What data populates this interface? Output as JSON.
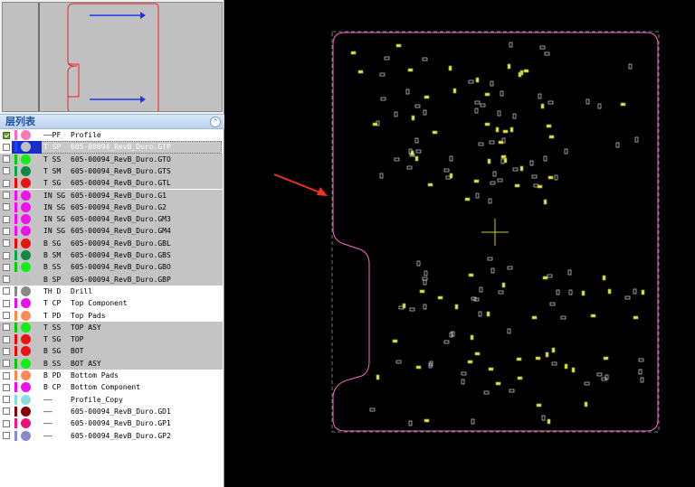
{
  "layer_panel": {
    "title": "层列表",
    "collapse_icon": "chevron-up-icon"
  },
  "layers": [
    {
      "code": "——PF",
      "name": "Profile",
      "bar": "#ff66cc",
      "dot": "#ff77bb",
      "checked": true,
      "shade": "white"
    },
    {
      "code": "T SP",
      "name": "605-00094_RevB_Duro.GTP",
      "bar": "#2040ff",
      "dot": "#c0c0c0",
      "checked": false,
      "shade": "selected"
    },
    {
      "code": "T SS",
      "name": "605-00094_RevB_Duro.GTO",
      "bar": "#00cc00",
      "dot": "#11ee11",
      "checked": false,
      "shade": "grey"
    },
    {
      "code": "T SM",
      "name": "605-00094_RevB_Duro.GTS",
      "bar": "#00aa44",
      "dot": "#118844",
      "checked": false,
      "shade": "grey"
    },
    {
      "code": "T SG",
      "name": "605-00094_RevB_Duro.GTL",
      "bar": "#ff0000",
      "dot": "#ee1111",
      "checked": false,
      "shade": "grey"
    },
    {
      "code": "IN SG",
      "name": "605-00094_RevB_Duro.G1",
      "bar": "#ff00ff",
      "dot": "#ee11ee",
      "checked": false,
      "shade": "grey"
    },
    {
      "code": "IN SG",
      "name": "605-00094_RevB_Duro.G2",
      "bar": "#ff00ff",
      "dot": "#ee11ee",
      "checked": false,
      "shade": "grey"
    },
    {
      "code": "IN SG",
      "name": "605-00094_RevB_Duro.GM3",
      "bar": "#ff00ff",
      "dot": "#ee11ee",
      "checked": false,
      "shade": "grey"
    },
    {
      "code": "IN SG",
      "name": "605-00094_RevB_Duro.GM4",
      "bar": "#ff00ff",
      "dot": "#ee11ee",
      "checked": false,
      "shade": "grey"
    },
    {
      "code": "B SG",
      "name": "605-00094_RevB_Duro.GBL",
      "bar": "#ff0000",
      "dot": "#ee1111",
      "checked": false,
      "shade": "grey"
    },
    {
      "code": "B SM",
      "name": "605-00094_RevB_Duro.GBS",
      "bar": "#00aa44",
      "dot": "#118844",
      "checked": false,
      "shade": "grey"
    },
    {
      "code": "B SS",
      "name": "605-00094_RevB_Duro.GBO",
      "bar": "#00cc00",
      "dot": "#11ee11",
      "checked": false,
      "shade": "grey"
    },
    {
      "code": "B SP",
      "name": "605-00094_RevB_Duro.GBP",
      "bar": "#c0c0c0",
      "dot": "#c0c0c0",
      "checked": false,
      "shade": "grey"
    },
    {
      "code": "TH D",
      "name": "Drill",
      "bar": "#888888",
      "dot": "#888888",
      "checked": false,
      "shade": "white"
    },
    {
      "code": "T CP",
      "name": "Top Component",
      "bar": "#ff00ff",
      "dot": "#ee11ee",
      "checked": false,
      "shade": "white"
    },
    {
      "code": "T PD",
      "name": "Top Pads",
      "bar": "#ff8844",
      "dot": "#ff8855",
      "checked": false,
      "shade": "white"
    },
    {
      "code": "T SS",
      "name": "TOP ASY",
      "bar": "#00cc00",
      "dot": "#11ee11",
      "checked": false,
      "shade": "grey"
    },
    {
      "code": "T SG",
      "name": "TOP",
      "bar": "#ff0000",
      "dot": "#ee1111",
      "checked": false,
      "shade": "grey"
    },
    {
      "code": "B SG",
      "name": "BOT",
      "bar": "#ff0000",
      "dot": "#ee1111",
      "checked": false,
      "shade": "grey"
    },
    {
      "code": "B SS",
      "name": "BOT ASY",
      "bar": "#00cc00",
      "dot": "#11ee11",
      "checked": false,
      "shade": "grey"
    },
    {
      "code": "B PD",
      "name": "Bottom Pads",
      "bar": "#ff8844",
      "dot": "#ff8855",
      "checked": false,
      "shade": "white"
    },
    {
      "code": "B CP",
      "name": "Bottom Component",
      "bar": "#ff00ff",
      "dot": "#ee11ee",
      "checked": false,
      "shade": "white"
    },
    {
      "code": "——",
      "name": "Profile_Copy",
      "bar": "#88dddd",
      "dot": "#88dddd",
      "checked": false,
      "shade": "white"
    },
    {
      "code": "——",
      "name": "605-00094_RevB_Duro.GD1",
      "bar": "#880000",
      "dot": "#880000",
      "checked": false,
      "shade": "white"
    },
    {
      "code": "——",
      "name": "605-00094_RevB_Duro.GP1",
      "bar": "#ff1188",
      "dot": "#ee1177",
      "checked": false,
      "shade": "white"
    },
    {
      "code": "——",
      "name": "605-00094_RevB_Duro.GP2",
      "bar": "#8888dd",
      "dot": "#8888cc",
      "checked": false,
      "shade": "white"
    }
  ],
  "colors": {
    "board_outline": "#ff66cc",
    "pad_outline": "#d8d8d8",
    "pad_fill": "#e8e84a",
    "crosshair": "#cccc33",
    "annotation_arrow": "#ee3322",
    "preview_arrows": "#2233ee",
    "preview_outline": "#ee2222"
  }
}
